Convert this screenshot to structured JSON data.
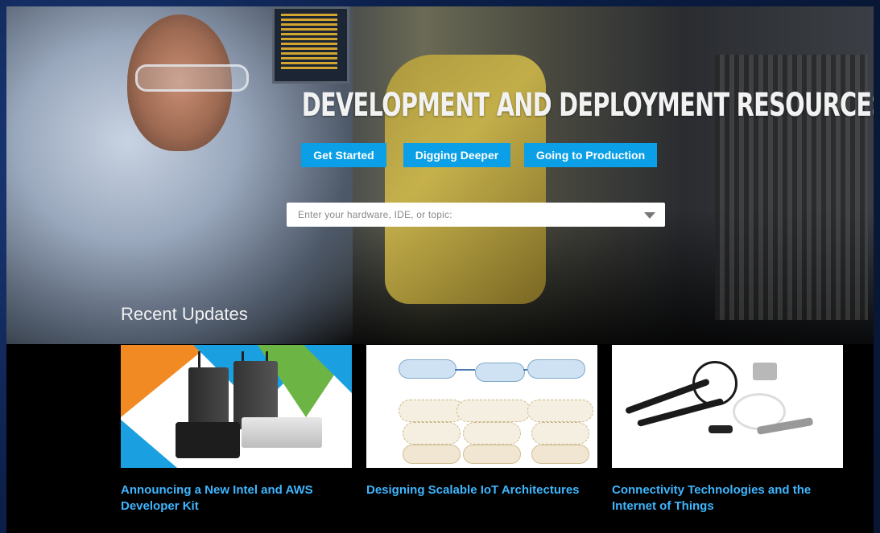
{
  "hero": {
    "title": "DEVELOPMENT AND DEPLOYMENT RESOURCES",
    "buttons": [
      {
        "label": "Get Started"
      },
      {
        "label": "Digging Deeper"
      },
      {
        "label": "Going to Production"
      }
    ],
    "search": {
      "placeholder": "Enter your hardware, IDE, or topic:"
    }
  },
  "recent": {
    "heading": "Recent Updates",
    "items": [
      {
        "title": "Announcing a New Intel and AWS Developer Kit"
      },
      {
        "title": "Designing Scalable IoT Architectures"
      },
      {
        "title": "Connectivity Technologies and the Internet of Things"
      }
    ]
  },
  "colors": {
    "accent": "#0a9fe6",
    "link": "#3fb6ff",
    "background": "#000000"
  }
}
